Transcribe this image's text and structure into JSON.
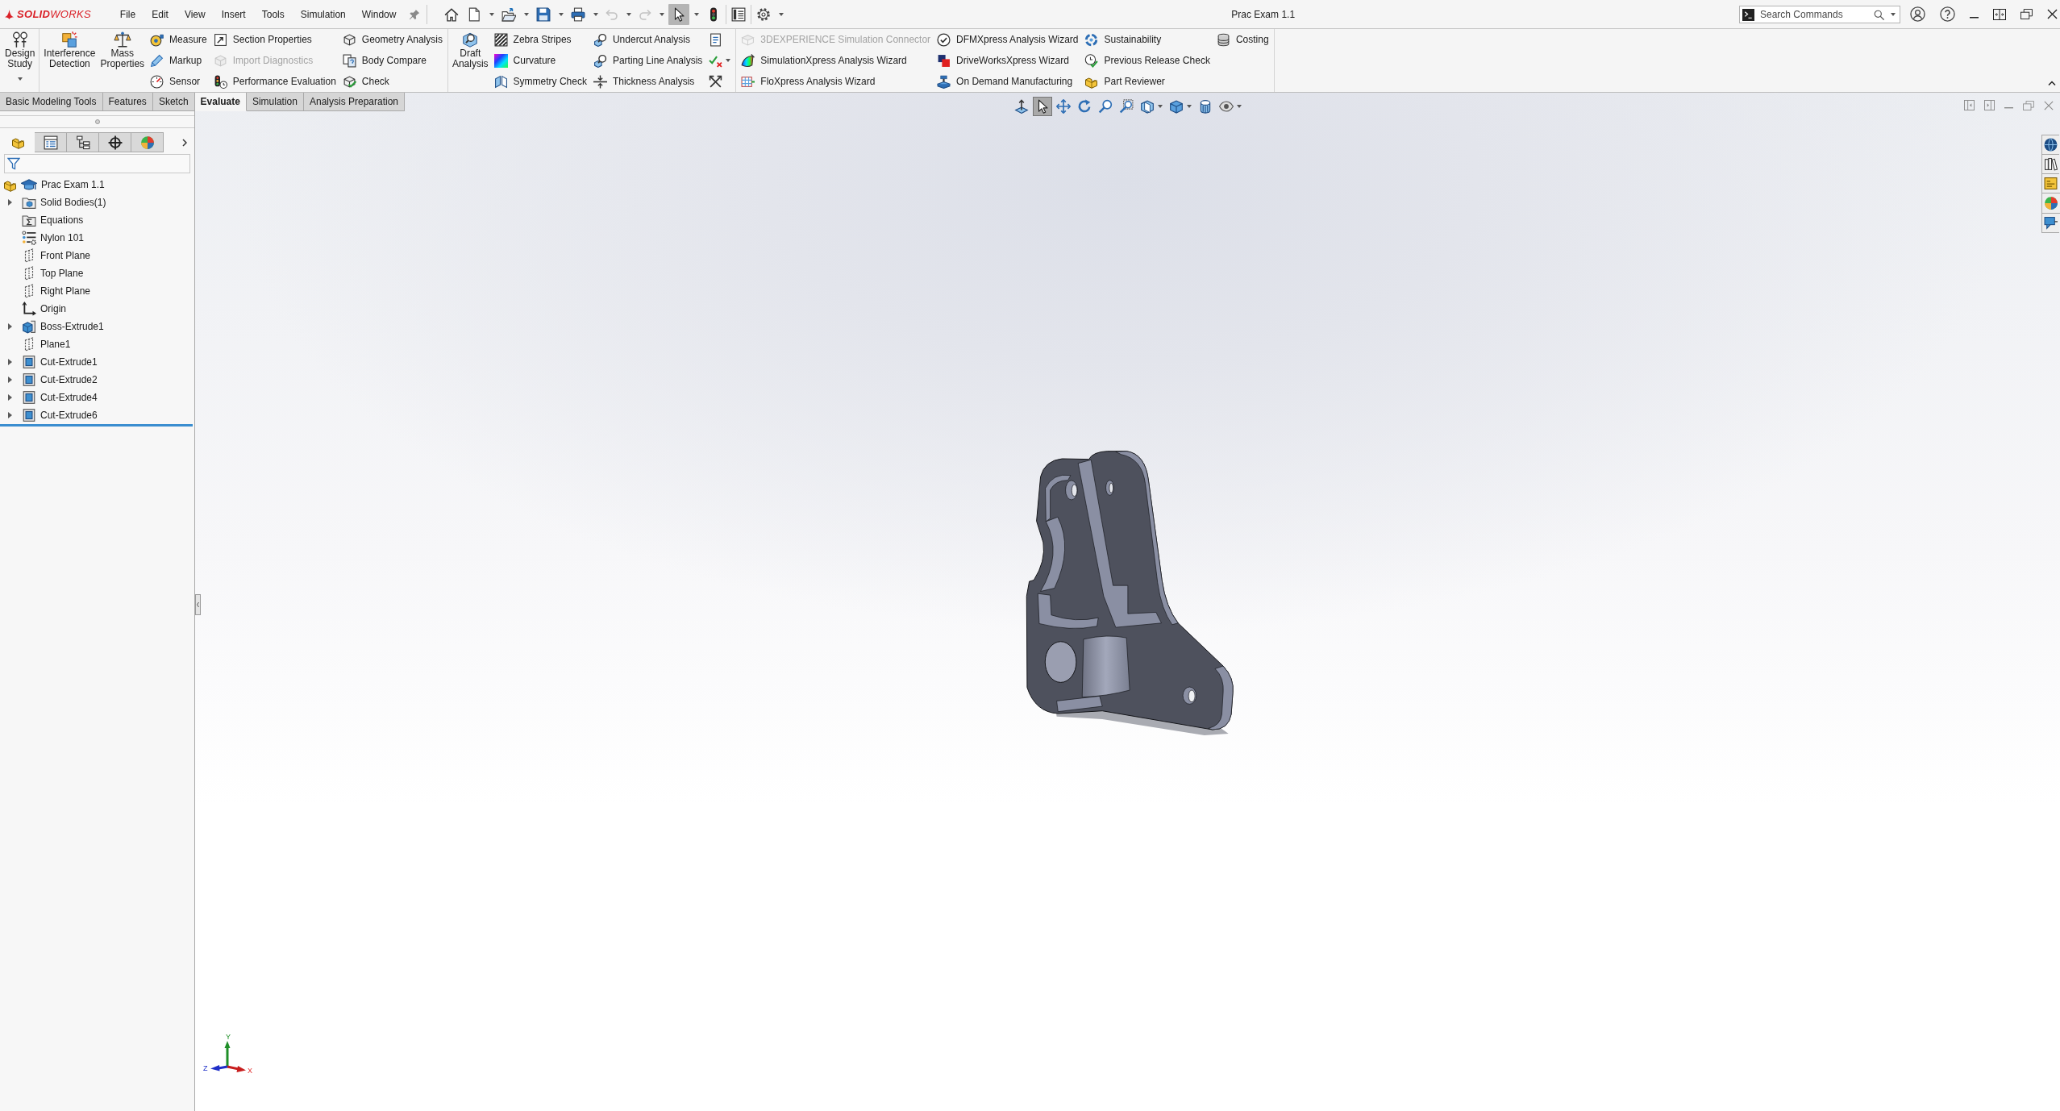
{
  "app": {
    "logo": "**SOLID**WORKS"
  },
  "menu": [
    "File",
    "Edit",
    "View",
    "Insert",
    "Tools",
    "Simulation",
    "Window"
  ],
  "quick_access": [
    {
      "dropdown": false,
      "selected": false,
      "disabled": false
    },
    {
      "dropdown": true,
      "selected": false,
      "disabled": false
    },
    {
      "dropdown": true,
      "selected": false,
      "disabled": false
    },
    {
      "dropdown": true,
      "selected": false,
      "disabled": false
    },
    {
      "dropdown": true,
      "selected": false,
      "disabled": false
    },
    {
      "dropdown": true,
      "selected": false,
      "disabled": true
    },
    {
      "dropdown": true,
      "selected": false,
      "disabled": true
    },
    {
      "dropdown": true,
      "selected": true,
      "disabled": false
    },
    {
      "dropdown": false,
      "selected": false,
      "disabled": false
    },
    {
      "dropdown": false,
      "selected": false,
      "disabled": false
    },
    {
      "dropdown": true,
      "selected": false,
      "disabled": false
    }
  ],
  "window": {
    "title": "Prac Exam 1.1"
  },
  "search": {
    "placeholder": "Search Commands"
  },
  "ribbon": {
    "groups": [
      {
        "columns": [
          {
            "kind": "large",
            "items": [
              {
                "label": "Design Study",
                "disabled": false,
                "dropdown": true
              }
            ]
          }
        ]
      },
      {
        "columns": [
          {
            "kind": "large",
            "items": [
              {
                "label": "Interference Detection",
                "disabled": false,
                "dropdown": false
              }
            ]
          },
          {
            "kind": "large",
            "items": [
              {
                "label": "Mass Properties",
                "disabled": false,
                "dropdown": false
              }
            ]
          },
          {
            "kind": "small",
            "items": [
              {
                "label": "Measure",
                "disabled": false,
                "dropdown": false
              },
              {
                "label": "Markup",
                "disabled": false,
                "dropdown": false
              },
              {
                "label": "Sensor",
                "disabled": false,
                "dropdown": false
              }
            ]
          },
          {
            "kind": "small",
            "items": [
              {
                "label": "Section Properties",
                "disabled": false,
                "dropdown": false
              },
              {
                "label": "Import Diagnostics",
                "disabled": true,
                "dropdown": false
              },
              {
                "label": "Performance Evaluation",
                "disabled": false,
                "dropdown": false
              }
            ]
          },
          {
            "kind": "small",
            "items": [
              {
                "label": "Geometry Analysis",
                "disabled": false,
                "dropdown": false
              },
              {
                "label": "Body Compare",
                "disabled": false,
                "dropdown": false
              },
              {
                "label": "Check",
                "disabled": false,
                "dropdown": false
              }
            ]
          }
        ]
      },
      {
        "columns": [
          {
            "kind": "large",
            "items": [
              {
                "label": "Draft Analysis",
                "disabled": false,
                "dropdown": false
              }
            ]
          },
          {
            "kind": "small",
            "items": [
              {
                "label": "Zebra Stripes",
                "disabled": false,
                "dropdown": false
              },
              {
                "label": "Curvature",
                "disabled": false,
                "dropdown": false
              },
              {
                "label": "Symmetry Check",
                "disabled": false,
                "dropdown": false
              }
            ]
          },
          {
            "kind": "small",
            "items": [
              {
                "label": "Undercut Analysis",
                "disabled": false,
                "dropdown": false
              },
              {
                "label": "Parting Line Analysis",
                "disabled": false,
                "dropdown": false
              },
              {
                "label": "Thickness Analysis",
                "disabled": false,
                "dropdown": false
              }
            ]
          },
          {
            "kind": "small",
            "items": [
              {
                "disabled": false,
                "dropdown": false
              },
              {
                "disabled": false,
                "dropdown": true
              },
              {
                "disabled": false,
                "dropdown": false
              }
            ]
          }
        ]
      },
      {
        "columns": [
          {
            "kind": "small",
            "items": [
              {
                "label": "3DEXPERIENCE Simulation Connector",
                "disabled": true,
                "dropdown": false
              },
              {
                "label": "SimulationXpress Analysis Wizard",
                "disabled": false,
                "dropdown": false
              },
              {
                "label": "FloXpress Analysis Wizard",
                "disabled": false,
                "dropdown": false
              }
            ]
          },
          {
            "kind": "small",
            "items": [
              {
                "label": "DFMXpress Analysis Wizard",
                "disabled": false,
                "dropdown": false
              },
              {
                "label": "DriveWorksXpress Wizard",
                "disabled": false,
                "dropdown": false
              },
              {
                "label": "On Demand Manufacturing",
                "disabled": false,
                "dropdown": false
              }
            ]
          },
          {
            "kind": "small",
            "items": [
              {
                "label": "Sustainability",
                "disabled": false,
                "dropdown": false
              },
              {
                "label": "Previous Release Check",
                "disabled": false,
                "dropdown": false
              },
              {
                "label": "Part Reviewer",
                "disabled": false,
                "dropdown": false
              }
            ]
          },
          {
            "kind": "small",
            "items": [
              {
                "label": "Costing",
                "disabled": false,
                "dropdown": false
              }
            ]
          }
        ]
      }
    ]
  },
  "ribbon_tabs": [
    {
      "label": "Basic Modeling Tools",
      "selected": false
    },
    {
      "label": "Features",
      "selected": false
    },
    {
      "label": "Sketch",
      "selected": false
    },
    {
      "label": "Evaluate",
      "selected": true
    },
    {
      "label": "Simulation",
      "selected": false
    },
    {
      "label": "Analysis Preparation",
      "selected": false
    }
  ],
  "feature_manager": {
    "tabs": [
      {
        "selected": true
      },
      {
        "selected": false
      },
      {
        "selected": false
      },
      {
        "selected": false
      },
      {
        "selected": false
      }
    ],
    "root": "Prac Exam 1.1",
    "items": [
      {
        "label": "Solid Bodies(1)",
        "expandable": true
      },
      {
        "label": "Equations",
        "expandable": false
      },
      {
        "label": "Nylon 101",
        "expandable": false
      },
      {
        "label": "Front Plane",
        "expandable": false
      },
      {
        "label": "Top Plane",
        "expandable": false
      },
      {
        "label": "Right Plane",
        "expandable": false
      },
      {
        "label": "Origin",
        "expandable": false
      },
      {
        "label": "Boss-Extrude1",
        "expandable": true
      },
      {
        "label": "Plane1",
        "expandable": false
      },
      {
        "label": "Cut-Extrude1",
        "expandable": true
      },
      {
        "label": "Cut-Extrude2",
        "expandable": true
      },
      {
        "label": "Cut-Extrude4",
        "expandable": true
      },
      {
        "label": "Cut-Extrude6",
        "expandable": true
      }
    ]
  },
  "view_toolbar": [
    {
      "selected": false,
      "dropdown": false
    },
    {
      "selected": true,
      "dropdown": false
    },
    {
      "selected": false,
      "dropdown": false
    },
    {
      "selected": false,
      "dropdown": false
    },
    {
      "selected": false,
      "dropdown": false
    },
    {
      "selected": false,
      "dropdown": false
    },
    {
      "selected": false,
      "dropdown": true
    },
    {
      "selected": false,
      "dropdown": true
    },
    {
      "selected": false,
      "dropdown": false
    },
    {
      "selected": false,
      "dropdown": true
    }
  ],
  "triad": {
    "y": "Y",
    "z": "Z",
    "x": "X"
  }
}
